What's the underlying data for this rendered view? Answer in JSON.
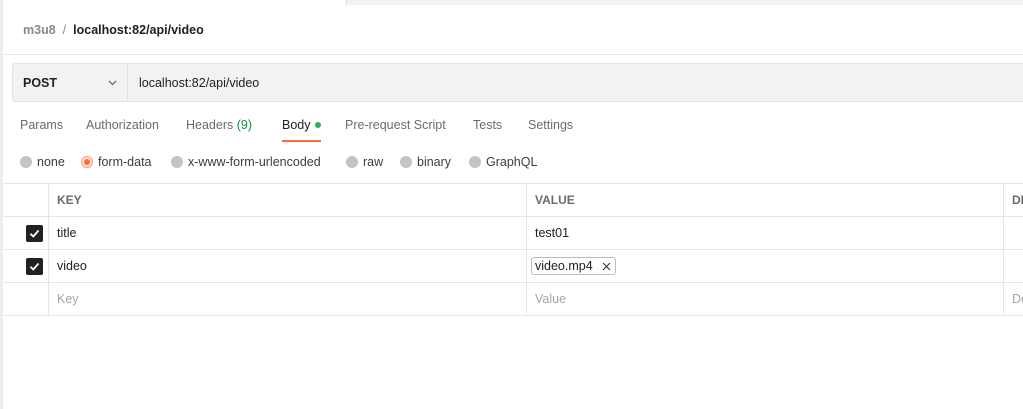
{
  "breadcrumb": {
    "collection": "m3u8",
    "separator": "/",
    "request": "localhost:82/api/video"
  },
  "request": {
    "method": "POST",
    "url": "localhost:82/api/video"
  },
  "tabs": [
    {
      "label": "Params",
      "count": ""
    },
    {
      "label": "Authorization",
      "count": ""
    },
    {
      "label": "Headers",
      "count": "(9)"
    },
    {
      "label": "Body",
      "count": "",
      "active": true
    },
    {
      "label": "Pre-request Script",
      "count": ""
    },
    {
      "label": "Tests",
      "count": ""
    },
    {
      "label": "Settings",
      "count": ""
    }
  ],
  "body_types": [
    {
      "label": "none",
      "selected": false
    },
    {
      "label": "form-data",
      "selected": true
    },
    {
      "label": "x-www-form-urlencoded",
      "selected": false
    },
    {
      "label": "raw",
      "selected": false
    },
    {
      "label": "binary",
      "selected": false
    },
    {
      "label": "GraphQL",
      "selected": false
    }
  ],
  "table": {
    "headers": {
      "key": "KEY",
      "value": "VALUE",
      "description": "DE"
    },
    "rows": [
      {
        "checked": true,
        "key": "title",
        "value": "test01"
      },
      {
        "checked": true,
        "key": "video",
        "file": "video.mp4"
      }
    ],
    "placeholders": {
      "key": "Key",
      "value": "Value",
      "description": "De"
    }
  },
  "icons": {
    "method_dropdown": "chevron-down-icon",
    "checkbox": "checkmark-icon",
    "remove_file": "close-icon"
  },
  "colors": {
    "accent": "#ff6c37",
    "body_dot": "#2fae5b",
    "count": "#0f8f4a"
  }
}
